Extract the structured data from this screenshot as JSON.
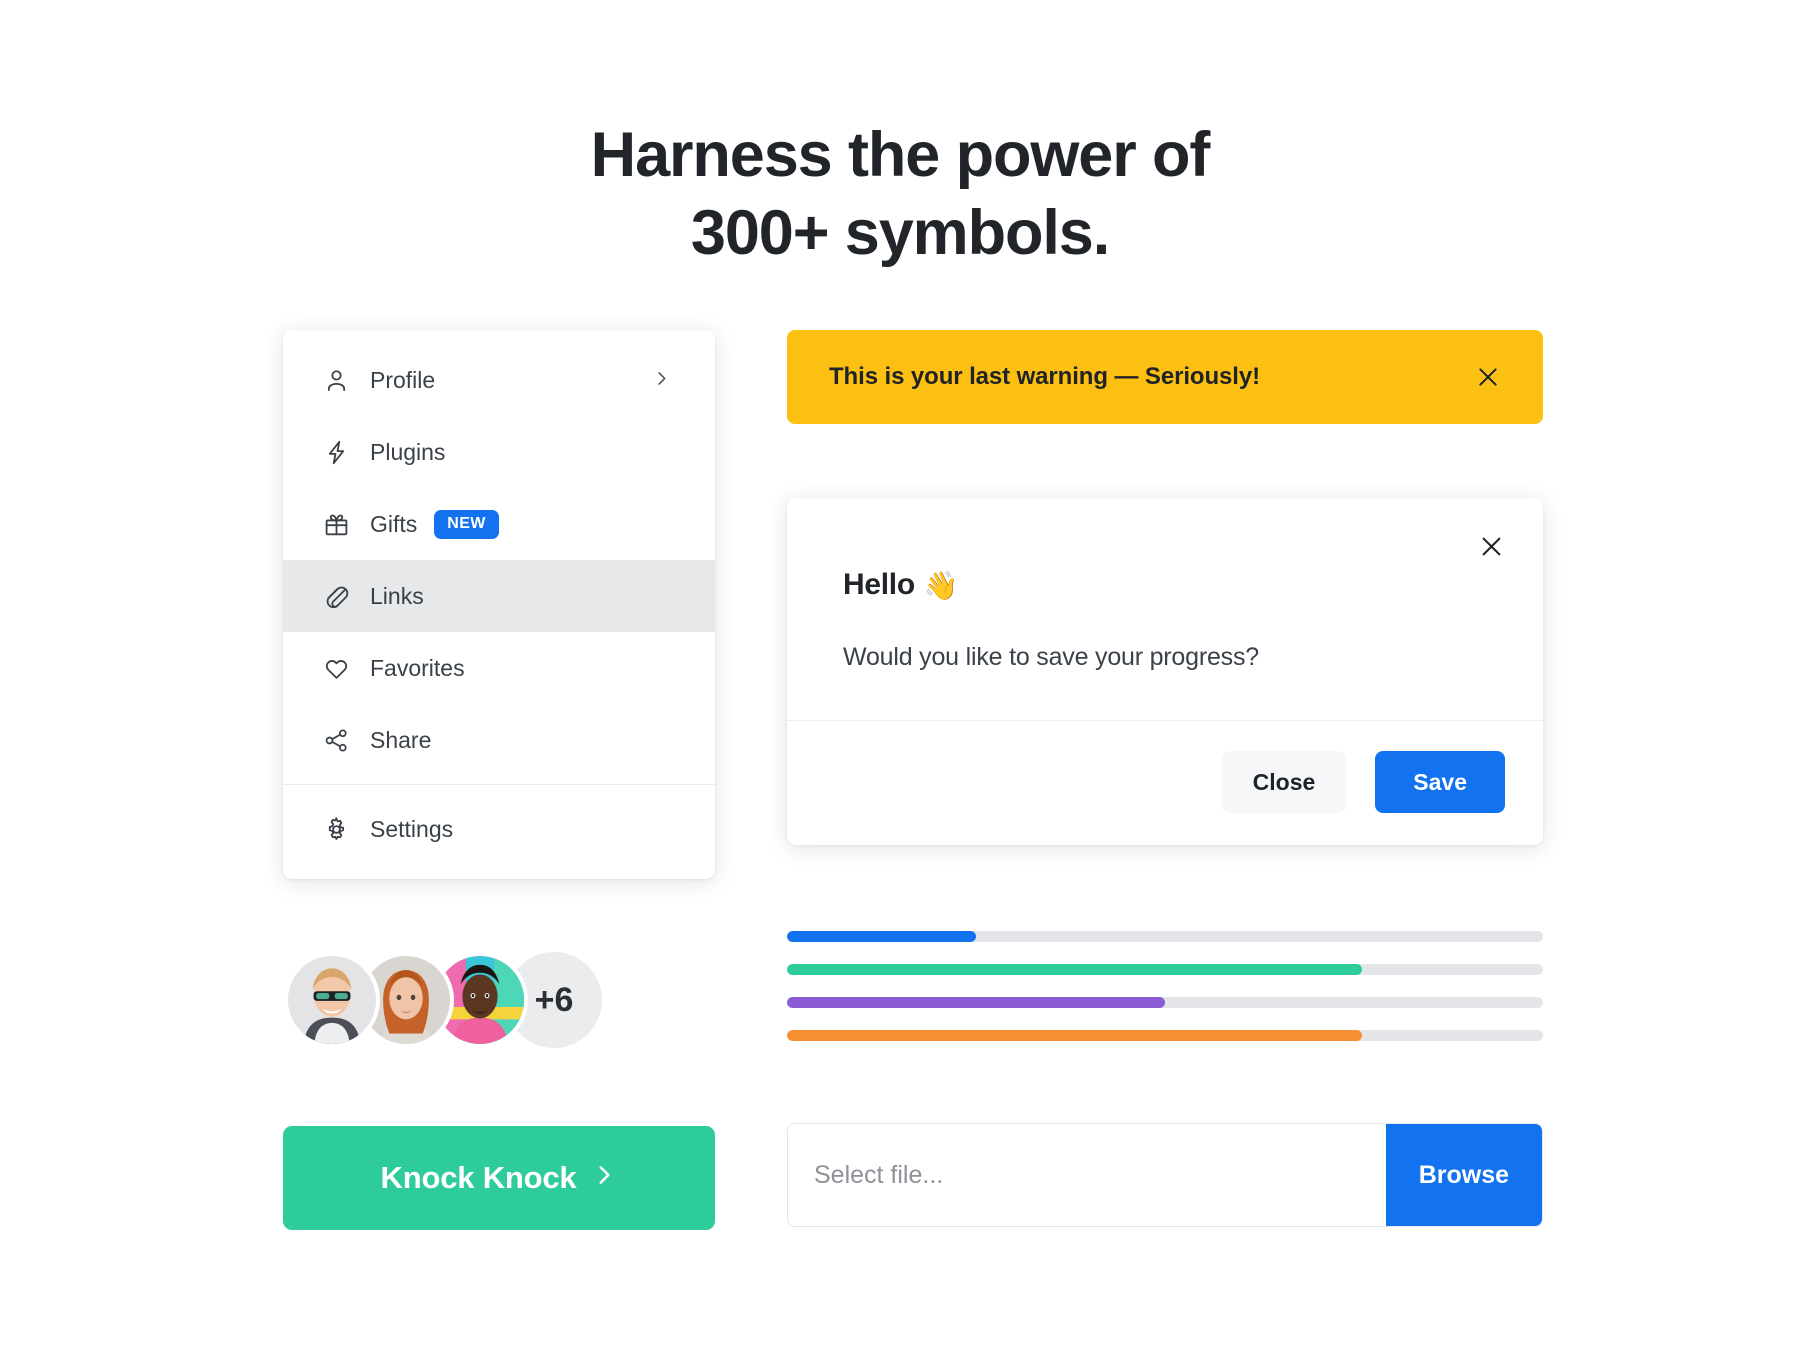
{
  "hero": {
    "line1": "Harness the power of",
    "line2": "300+ symbols."
  },
  "sidebar": {
    "items": [
      {
        "label": "Profile",
        "icon": "user-icon",
        "badge": null,
        "chevron": true,
        "active": false
      },
      {
        "label": "Plugins",
        "icon": "bolt-icon",
        "badge": null,
        "chevron": false,
        "active": false
      },
      {
        "label": "Gifts",
        "icon": "gift-icon",
        "badge": "NEW",
        "chevron": false,
        "active": false
      },
      {
        "label": "Links",
        "icon": "paperclip-icon",
        "badge": null,
        "chevron": false,
        "active": true
      },
      {
        "label": "Favorites",
        "icon": "heart-icon",
        "badge": null,
        "chevron": false,
        "active": false
      },
      {
        "label": "Share",
        "icon": "share-icon",
        "badge": null,
        "chevron": false,
        "active": false
      },
      {
        "label": "Settings",
        "icon": "gear-icon",
        "badge": null,
        "chevron": false,
        "active": false
      }
    ],
    "badge_color": "#1272f0",
    "active_bg": "#e6e8ea"
  },
  "avatars": {
    "count_label": "+6",
    "people": [
      "avatar-man-sunglasses",
      "avatar-woman-red-hair",
      "avatar-man-colorful-shirt"
    ]
  },
  "knock_button": {
    "label": "Knock Knock",
    "icon": "chevron-right-icon",
    "color": "#2ecc9b"
  },
  "alert": {
    "text": "This is your last warning — Seriously!",
    "close_icon": "close-icon",
    "background": "#fbc011"
  },
  "modal": {
    "title": "Hello",
    "title_emoji": "👋",
    "message": "Would you like to save your progress?",
    "close_icon": "close-icon",
    "buttons": {
      "close_label": "Close",
      "save_label": "Save",
      "save_color": "#1272f0"
    }
  },
  "progress_bars": [
    {
      "name": "progress-blue",
      "percent": 25,
      "color": "#1272f0"
    },
    {
      "name": "progress-green",
      "percent": 76,
      "color": "#2ecc9b"
    },
    {
      "name": "progress-purple",
      "percent": 50,
      "color": "#8b5cd6"
    },
    {
      "name": "progress-orange",
      "percent": 76,
      "color": "#f79033"
    }
  ],
  "file_picker": {
    "placeholder": "Select file...",
    "value": "",
    "button_label": "Browse",
    "button_color": "#1272f0"
  }
}
